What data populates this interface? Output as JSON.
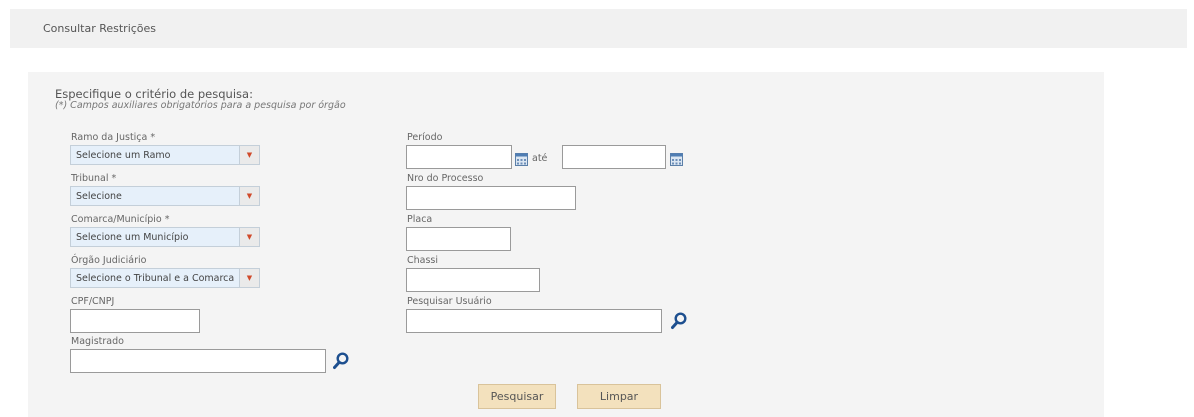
{
  "page": {
    "title": "Consultar Restrições"
  },
  "form": {
    "heading": "Especifique o critério de pesquisa:",
    "note": "(*) Campos auxiliares obrigatórios para a pesquisa por órgão",
    "ramo": {
      "label": "Ramo da Justiça *",
      "value": "Selecione um Ramo"
    },
    "tribunal": {
      "label": "Tribunal *",
      "value": "Selecione"
    },
    "comarca": {
      "label": "Comarca/Município *",
      "value": "Selecione um Município"
    },
    "orgao": {
      "label": "Órgão Judiciário",
      "value": "Selecione o Tribunal e a Comarca"
    },
    "cpf": {
      "label": "CPF/CNPJ",
      "value": ""
    },
    "magistrado": {
      "label": "Magistrado",
      "value": ""
    },
    "periodo": {
      "label": "Período",
      "start": "",
      "separator": "até",
      "end": ""
    },
    "processo": {
      "label": "Nro do Processo",
      "value": ""
    },
    "placa": {
      "label": "Placa",
      "value": ""
    },
    "chassi": {
      "label": "Chassi",
      "value": ""
    },
    "usuario": {
      "label": "Pesquisar Usuário",
      "value": ""
    }
  },
  "buttons": {
    "search": "Pesquisar",
    "clear": "Limpar"
  },
  "icons": {
    "calendar": "calendar-icon",
    "search": "magnifier-icon",
    "dropdown": "chevron-down-icon",
    "search_color": "#1d4f8f"
  }
}
